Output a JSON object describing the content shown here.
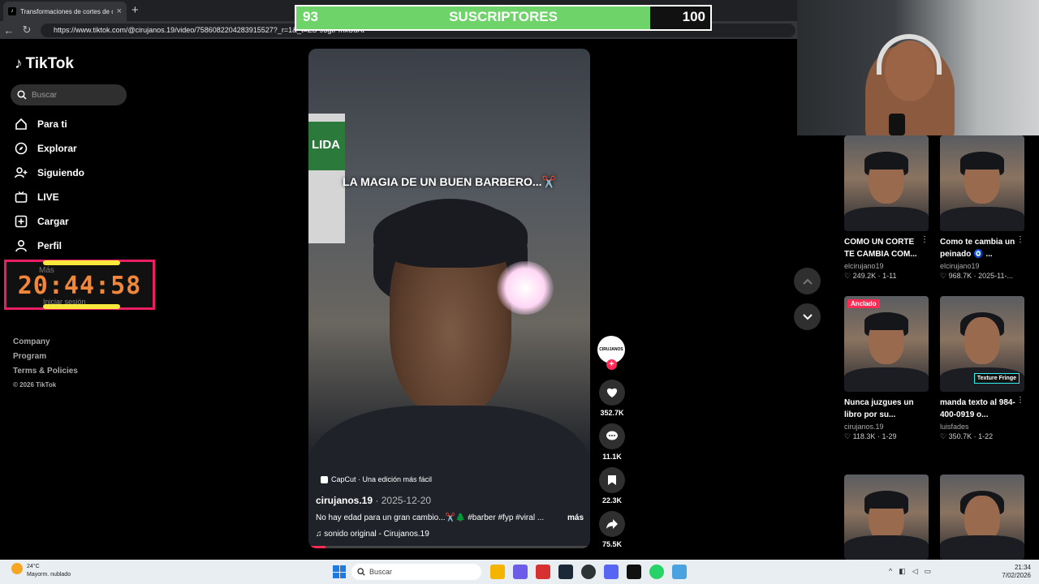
{
  "browser": {
    "tab_title": "Transformaciones de cortes de cab",
    "url": "https://www.tiktok.com/@cirujanos.19/video/7586082204283915527?_r=1&_t=ZS-93gtPmxUuAt"
  },
  "overlay_subs": {
    "current": "93",
    "label": "SUSCRIPTORES",
    "goal": "100",
    "progress_fraction": 0.93,
    "fill_color": "#6ed46a"
  },
  "sidebar": {
    "logo": "TikTok",
    "search_placeholder": "Buscar",
    "items": [
      {
        "label": "Para ti",
        "icon": "home-icon"
      },
      {
        "label": "Explorar",
        "icon": "compass-icon"
      },
      {
        "label": "Siguiendo",
        "icon": "user-follow-icon"
      },
      {
        "label": "LIVE",
        "icon": "live-icon"
      },
      {
        "label": "Cargar",
        "icon": "upload-icon"
      },
      {
        "label": "Perfil",
        "icon": "profile-icon"
      }
    ],
    "more_label": "Más",
    "login_label": "Iniciar sesión",
    "footer": [
      "Company",
      "Program",
      "Terms & Policies"
    ],
    "copyright": "© 2026 TikTok"
  },
  "timer": {
    "value": "20:44:58"
  },
  "video": {
    "caption_overlay": "LA MAGIA DE UN BUEN BARBERO...✂️",
    "capcut_label": "CapCut · Una edición más fácil",
    "author": "cirujanos.19",
    "date": "2025-12-20",
    "description": "No hay edad para un gran cambio...✂️🌲 #barber #fyp #viral ...",
    "more_label": "más",
    "sound": "sonido original - Cirujanos.19",
    "avatar_text": "CIRUJANOS",
    "likes": "352.7K",
    "comments": "11.1K",
    "saves": "22.3K",
    "shares": "75.5K",
    "progress_fraction": 0.06
  },
  "recommendations": [
    {
      "title": "COMO UN CORTE TE CAMBIA COM...",
      "author": "elcirujano19",
      "likes": "249.2K",
      "date": "1-11",
      "badge": "",
      "tag": ""
    },
    {
      "title": "Como te cambia un peinado 🧿 ...",
      "author": "elcirujano19",
      "likes": "968.7K",
      "date": "2025-11-...",
      "badge": "",
      "tag": ""
    },
    {
      "title": "Nunca juzgues un libro por su...",
      "author": "cirujanos.19",
      "likes": "118.3K",
      "date": "1-29",
      "badge": "Anclado",
      "tag": ""
    },
    {
      "title": "manda texto al 984-400-0919 o...",
      "author": "luisfades",
      "likes": "350.7K",
      "date": "1-22",
      "badge": "",
      "tag": "Texture Fringe"
    },
    {
      "title": "",
      "author": "",
      "likes": "",
      "date": "",
      "badge": "",
      "tag": ""
    },
    {
      "title": "",
      "author": "",
      "likes": "",
      "date": "",
      "badge": "",
      "tag": ""
    }
  ],
  "taskbar": {
    "temperature": "24°C",
    "weather": "Mayorm. nublado",
    "search_placeholder": "Buscar",
    "time": "21:34",
    "date": "7/02/2026"
  }
}
